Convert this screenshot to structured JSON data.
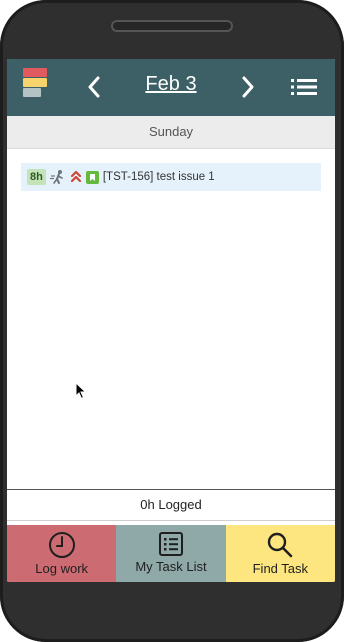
{
  "header": {
    "date": "Feb 3",
    "logo_icon": "app-logo-stack",
    "prev_icon": "chevron-left-icon",
    "next_icon": "chevron-right-icon",
    "menu_icon": "list-menu-icon",
    "background_color": "#3d6066"
  },
  "day_bar": {
    "weekday": "Sunday"
  },
  "tasks": [
    {
      "hours": "8h",
      "icons": [
        "assignee-walking-icon",
        "priority-high-icon",
        "story-bookmark-icon"
      ],
      "text": "[TST-156] test issue 1"
    }
  ],
  "summary": {
    "logged": "0h Logged"
  },
  "bottom_nav": [
    {
      "label": "Log work",
      "icon": "clock-icon",
      "color": "#cd6b72"
    },
    {
      "label": "My Task List",
      "icon": "checklist-icon",
      "color": "#8fa8a8"
    },
    {
      "label": "Find Task",
      "icon": "search-icon",
      "color": "#fde57f"
    }
  ]
}
